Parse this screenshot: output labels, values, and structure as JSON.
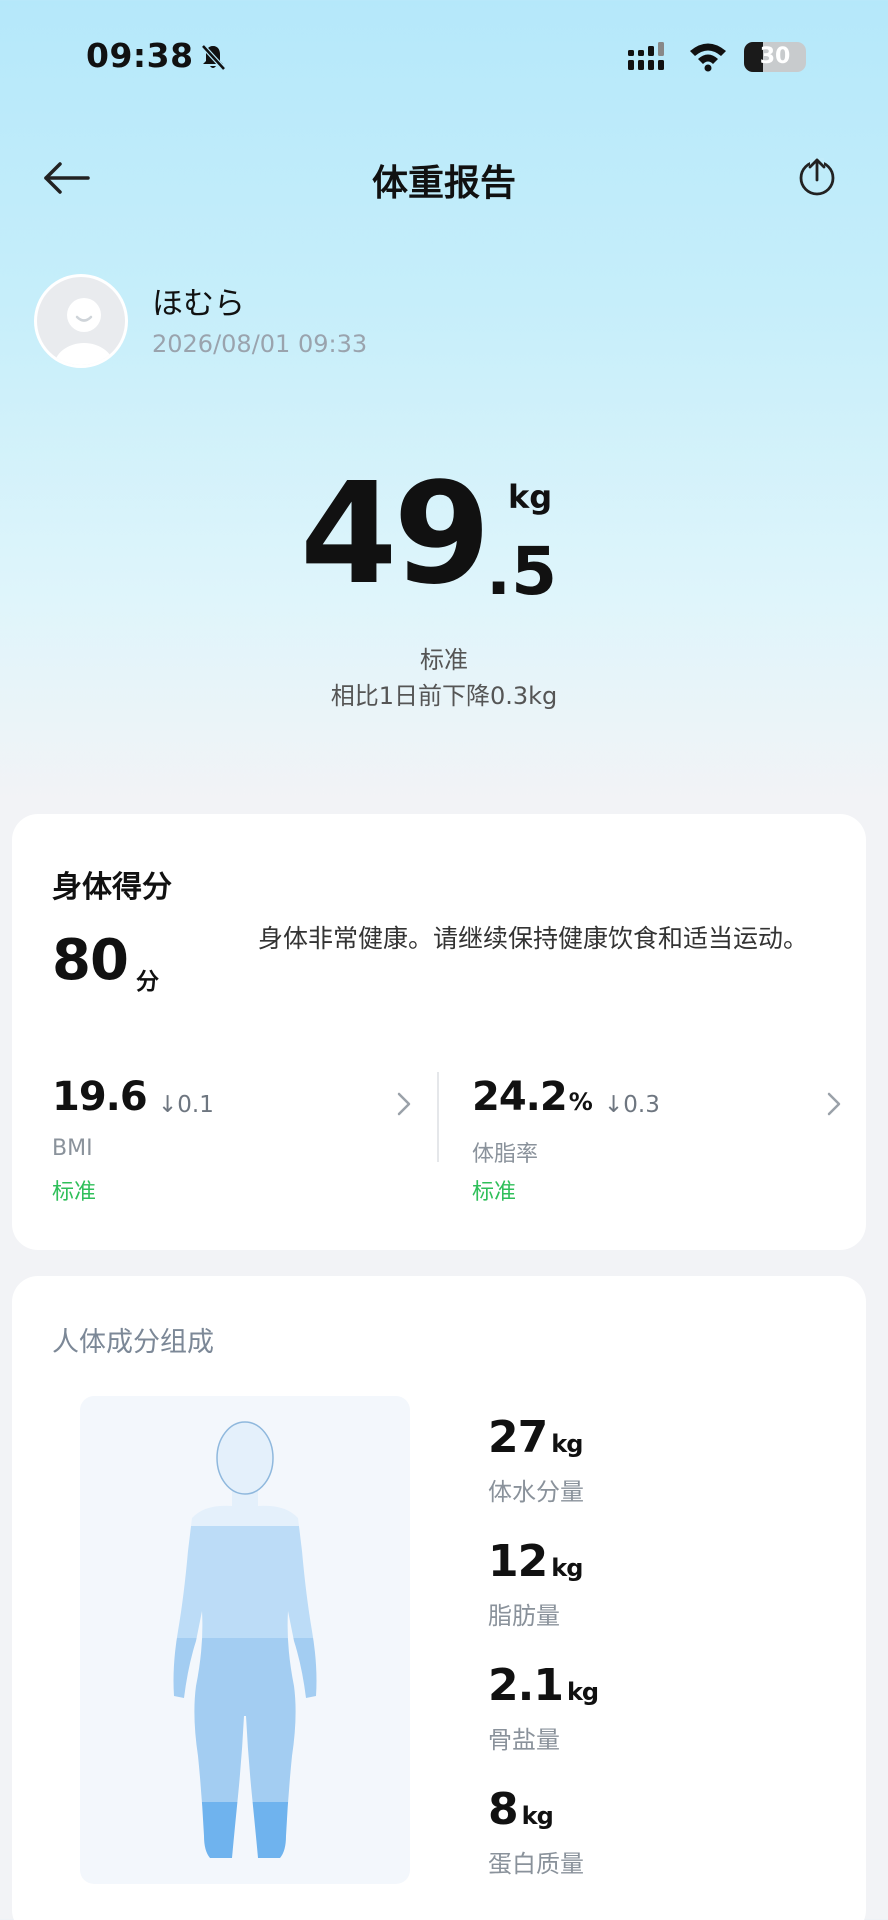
{
  "status_bar": {
    "time": "09:38",
    "battery": "30"
  },
  "nav": {
    "title": "体重报告"
  },
  "profile": {
    "name": "ほむら",
    "datetime": "2026/08/01 09:33"
  },
  "weight": {
    "integer": "49",
    "decimal": ".5",
    "unit": "kg",
    "status": "标准",
    "change": "相比1日前下降0.3kg"
  },
  "score_card": {
    "title": "身体得分",
    "score": "80",
    "score_unit": "分",
    "description": "身体非常健康。请继续保持健康饮食和适当运动。",
    "metrics": [
      {
        "value": "19.6",
        "unit": "",
        "delta": "↓0.1",
        "label": "BMI",
        "status": "标准"
      },
      {
        "value": "24.2",
        "unit": "%",
        "delta": "↓0.3",
        "label": "体脂率",
        "status": "标准"
      }
    ]
  },
  "composition": {
    "title": "人体成分组成",
    "items": [
      {
        "value": "27",
        "unit": "kg",
        "label": "体水分量"
      },
      {
        "value": "12",
        "unit": "kg",
        "label": "脂肪量"
      },
      {
        "value": "2.1",
        "unit": "kg",
        "label": "骨盐量"
      },
      {
        "value": "8",
        "unit": "kg",
        "label": "蛋白质量"
      }
    ]
  },
  "colors": {
    "accent_green": "#2fbf5a",
    "body_light": "#bcdcf7",
    "body_mid": "#a3cdf2",
    "body_dark": "#6fb3ee"
  }
}
